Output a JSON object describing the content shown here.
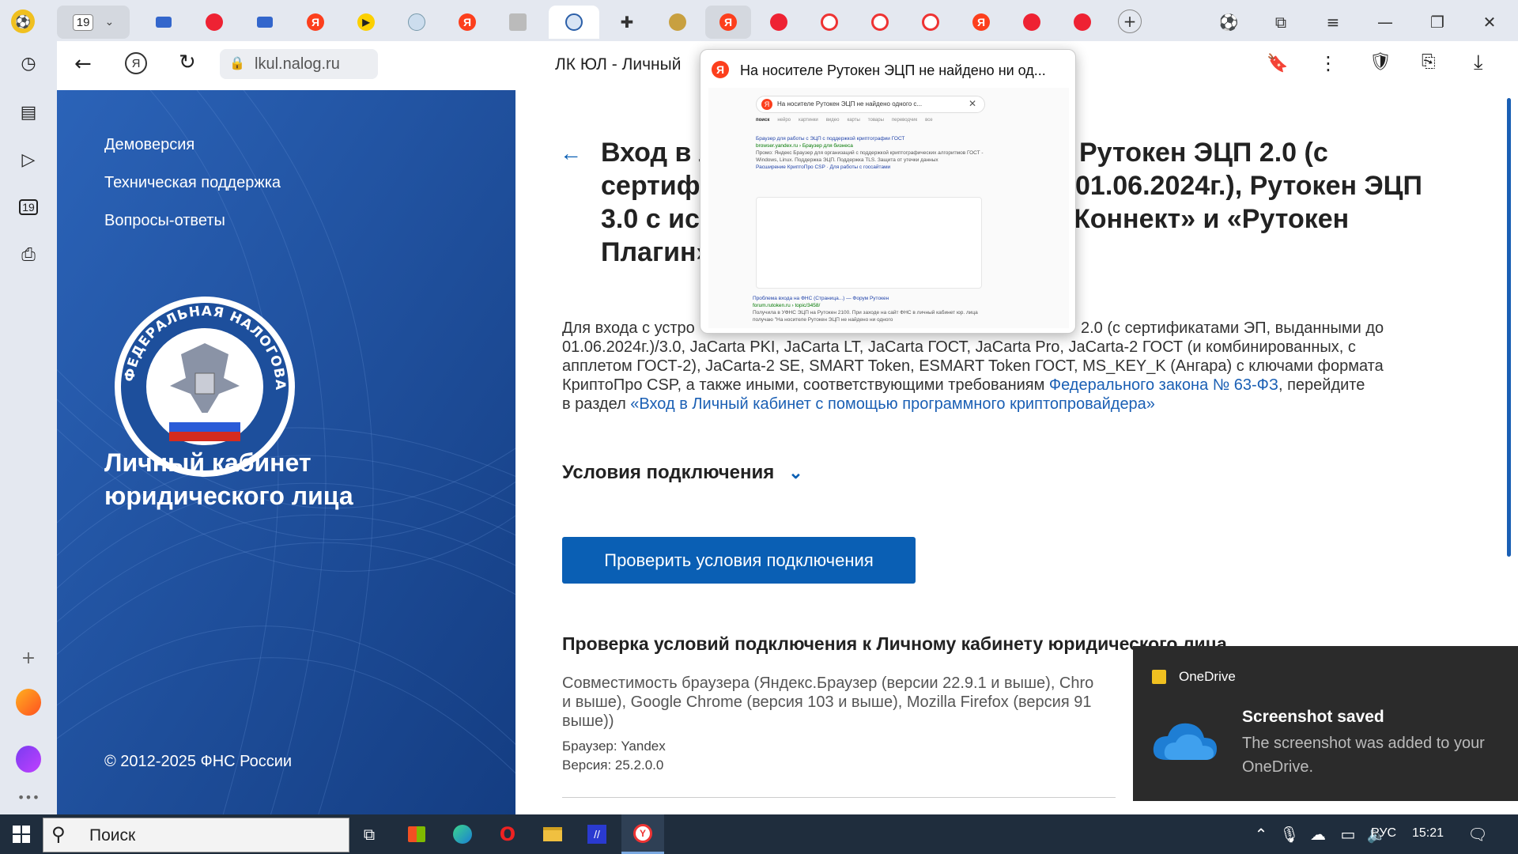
{
  "browser": {
    "tab_counter": "19",
    "tabs_count_badge": "19",
    "url": "lkul.nalog.ru",
    "page_title": "ЛК ЮЛ - Личный",
    "popup_title": "На носителе Рутокен ЭЦП не найдено ни од...",
    "popup_search_query": "На носителе Рутокен ЭЦП не найдено одного с...",
    "popup_tabs": [
      "поиск",
      "нейро",
      "картинки",
      "видео",
      "карты",
      "товары",
      "переводчик",
      "все"
    ],
    "popup_result1_title": "Браузер для работы с ЭЦП с поддержкой криптографии ГОСТ",
    "popup_result1_url": "browser.yandex.ru › Браузер для бизнеса",
    "popup_result1_snippet": "Промо: Яндекс Браузер для организаций с поддержкой криптографических алгоритмов ГОСТ - Windows, Linux. Поддержка ЭЦП. Поддержка TLS. Защита от утечки данных",
    "popup_result1_link": "Расширение КриптоПро CSP · Для работы с госсайтами",
    "popup_result2_title": "Проблема входа на ФНС (Страница...) — Форум Рутокен",
    "popup_result2_url": "forum.rutoken.ru › topic/3458/",
    "popup_result2_snippet": "Получила в УФНС ЭЦП на Рутокен 2100. При заходе на сайт ФНС в личный кабинет юр. лица получаю \"На носителе Рутокен ЭЦП не найдено ни одного"
  },
  "left_panel": {
    "links": [
      "Демоверсия",
      "Техническая поддержка",
      "Вопросы-ответы"
    ],
    "emblem_text": "ФЕДЕРАЛЬНАЯ НАЛОГОВАЯ СЛУЖБА",
    "cabinet_title_line1": "Личный кабинет",
    "cabinet_title_line2": "юридического лица",
    "copyright": "© 2012-2025 ФНС России"
  },
  "main": {
    "heading_lines": [
      "Вход в л",
      "Рутокен ЭЦП 2.0 (с",
      "сертиф",
      "01.06.2024г.), Рутокен ЭЦП",
      "3.0 с исп",
      "Коннект» и «Рутокен",
      "Плагин»"
    ],
    "para_line1_start": "Для входа с устро",
    "para_line1_end": "2.0 (с сертификатами ЭП, выданными до",
    "para_line2": "01.06.2024г.)/3.0, JaCarta PKI, JaCarta LT, JaCarta ГОСТ, JaCarta Pro, JaCarta-2 ГОСТ (и комбинированных, с",
    "para_line3": "апплетом ГОСТ-2), JaCarta-2 SE, SMART Token, ESMART Token ГОСТ, MS_KEY_K (Ангара) с ключами формата",
    "para_line4_start": "КриптоПро CSP, а также иными, соответствующими требованиям ",
    "para_link1": "Федерального закона № 63-ФЗ",
    "para_line4_end": ", перейдите",
    "para_line5_start": "в раздел ",
    "para_link2": "«Вход в Личный кабинет с помощью программного криптопровайдера»",
    "conditions_label": "Условия подключения",
    "check_button": "Проверить условия подключения",
    "check_heading": "Проверка условий подключения к Личному кабинету юридического лица",
    "compat_line1": "Совместимость браузера (Яндекс.Браузер (версии 22.9.1 и выше), Chro",
    "compat_line2": "и выше), Google Chrome (версия 103 и выше), Mozilla Firefox (версия 91",
    "compat_line3": "выше))",
    "browser_label": "Браузер: Yandex",
    "version_label": "Версия: 25.2.0.0"
  },
  "toast": {
    "app": "OneDrive",
    "title": "Screenshot saved",
    "body_line1": "The screenshot was added to your",
    "body_line2": "OneDrive."
  },
  "taskbar": {
    "search_placeholder": "Поиск",
    "language": "РУС",
    "time": "15:21"
  },
  "colors": {
    "link": "#1a5fb4",
    "button": "#0a5fb4",
    "left_panel": "#1d4f9c"
  }
}
